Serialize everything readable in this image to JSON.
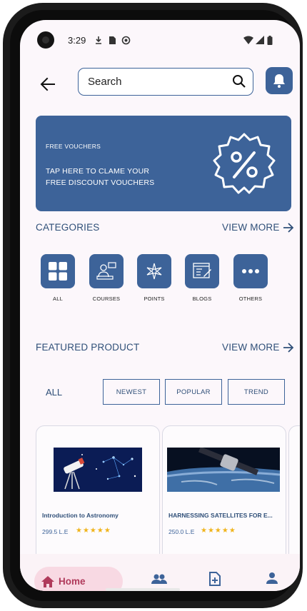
{
  "status_bar": {
    "time": "3:29"
  },
  "search": {
    "placeholder": "Search"
  },
  "banner": {
    "label": "FREE VOUCHERS",
    "line1": "TAP HERE TO CLAME YOUR",
    "line2": "FREE DISCOUNT VOUCHERS"
  },
  "categories": {
    "title": "CATEGORIES",
    "view_more": "VIEW MORE",
    "items": [
      {
        "label": "ALL",
        "icon": "grid-icon"
      },
      {
        "label": "COURSES",
        "icon": "courses-icon"
      },
      {
        "label": "POINTS",
        "icon": "points-icon"
      },
      {
        "label": "BLOGS",
        "icon": "blogs-icon"
      },
      {
        "label": "OTHERS",
        "icon": "more-icon"
      }
    ]
  },
  "featured": {
    "title": "FEATURED PRODUCT",
    "view_more": "VIEW MORE",
    "filter_all": "ALL",
    "filters": [
      "NEWEST",
      "POPULAR",
      "TREND"
    ]
  },
  "products": [
    {
      "title": "Introduction to Astronomy",
      "price": "299.5 L.E",
      "stars": "★★★★★",
      "rating": 5
    },
    {
      "title": "HARNESSING SATELLITES FOR E...",
      "price": "250.0 L.E",
      "stars": "★★★★★",
      "rating": 5
    }
  ],
  "nav": {
    "home_label": "Home"
  },
  "colors": {
    "primary": "#3d6399",
    "accent": "#b03a5b",
    "star": "#f0b41c"
  }
}
